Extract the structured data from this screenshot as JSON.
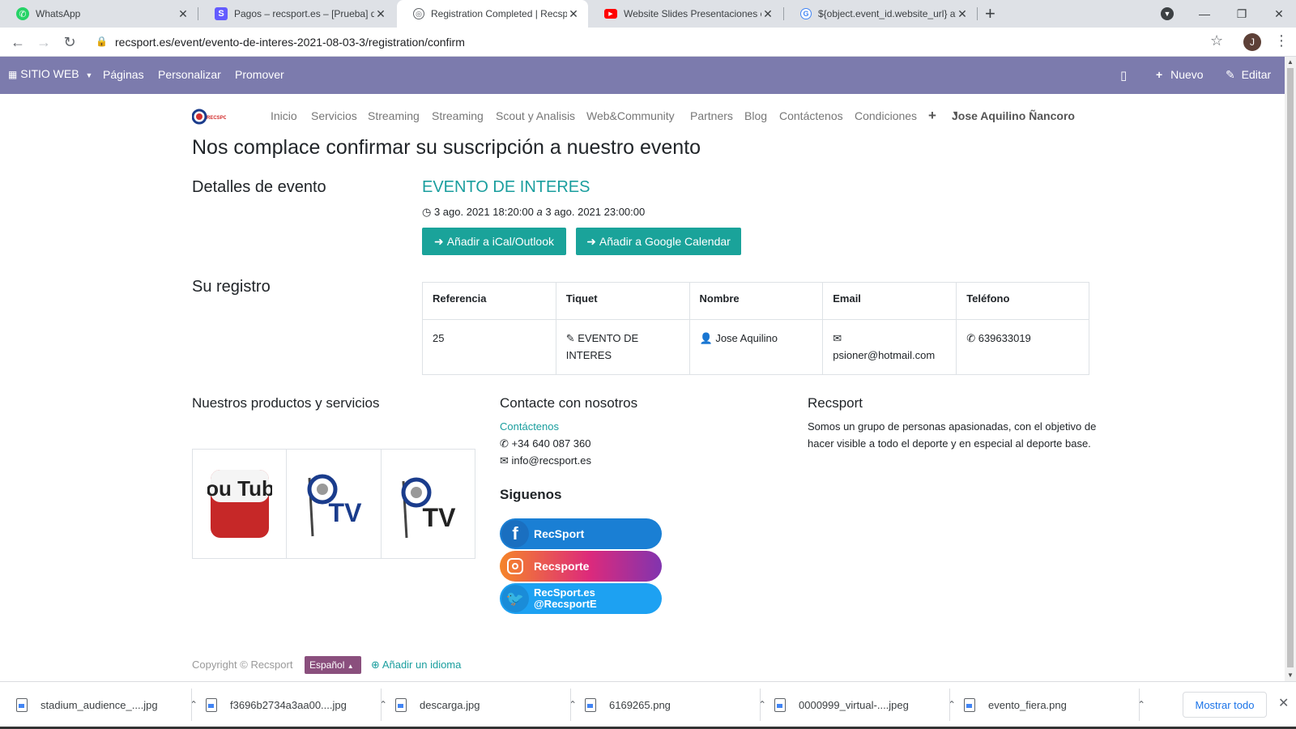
{
  "browser": {
    "tabs": [
      {
        "title": "WhatsApp",
        "icon": "whatsapp-icon"
      },
      {
        "title": "Pagos – recsport.es – [Prueba] de",
        "icon": "stripe-icon"
      },
      {
        "title": "Registration Completed | Recspo",
        "icon": "globe-icon"
      },
      {
        "title": "Website Slides Presentaciones en",
        "icon": "youtube-icon"
      },
      {
        "title": "${object.event_id.website_url} att",
        "icon": "google-icon"
      }
    ],
    "url": "recsport.es/event/evento-de-interes-2021-08-03-3/registration/confirm",
    "profile_initial": "J"
  },
  "editbar": {
    "site_menu": "SITIO WEB",
    "pages": "Páginas",
    "customize": "Personalizar",
    "promote": "Promover",
    "new": "Nuevo",
    "edit": "Editar"
  },
  "site_nav": {
    "items": [
      "Inicio",
      "Servicios",
      "Streaming",
      "Streaming",
      "Scout y Analisis",
      "Web&Community",
      "Partners",
      "Blog",
      "Contáctenos",
      "Condiciones"
    ],
    "add": "+",
    "user": "Jose Aquilino Ñancoro"
  },
  "main": {
    "title": "Nos complace confirmar su suscripción a nuestro evento",
    "event_details_heading": "Detalles de evento",
    "event_name": "EVENTO DE INTERES",
    "event_date": "3 ago. 2021 18:20:00",
    "event_date_sep": "a",
    "event_date_end": "3 ago. 2021 23:00:00",
    "btn_ical": "Añadir a iCal/Outlook",
    "btn_google": "Añadir a Google Calendar",
    "registration_heading": "Su registro",
    "table": {
      "headers": [
        "Referencia",
        "Tiquet",
        "Nombre",
        "Email",
        "Teléfono"
      ],
      "row": {
        "ref": "25",
        "ticket": "EVENTO DE INTERES",
        "name": "Jose Aquilino",
        "email": "psioner@hotmail.com",
        "phone": "639633019"
      }
    }
  },
  "footer": {
    "products_heading": "Nuestros productos y servicios",
    "products": [
      {
        "name": "youtube-logo",
        "text": "You Tube"
      },
      {
        "name": "recsport-tv-logo",
        "text": "TV"
      },
      {
        "name": "recsport-live-tv-logo",
        "text": "TV"
      }
    ],
    "contact_heading": "Contacte con nosotros",
    "contact_link": "Contáctenos",
    "phone": "+34 640 087 360",
    "email": "info@recsport.es",
    "follow_heading": "Siguenos",
    "social": [
      {
        "label": "RecSport",
        "color": "#1a7fd4"
      },
      {
        "label": "Recsporte",
        "color": "#e1306c"
      },
      {
        "label": "RecSport.es @RecsportE",
        "color": "#1da1f2"
      }
    ],
    "about_heading": "Recsport",
    "about_text": "Somos un grupo de personas apasionadas, con el objetivo de hacer visible a todo el deporte y en especial al deporte base.",
    "copyright": "Copyright © Recsport",
    "language": "Español",
    "add_language": "Añadir un idioma"
  },
  "downloads": {
    "files": [
      "stadium_audience_....jpg",
      "f3696b2734a3aa00....jpg",
      "descarga.jpg",
      "6169265.png",
      "0000999_virtual-....jpeg",
      "evento_fiera.png"
    ],
    "show_all": "Mostrar todo"
  },
  "colors": {
    "editbar": "#7c7bad",
    "teal": "#1aa39a",
    "link": "#1a9e9e"
  }
}
